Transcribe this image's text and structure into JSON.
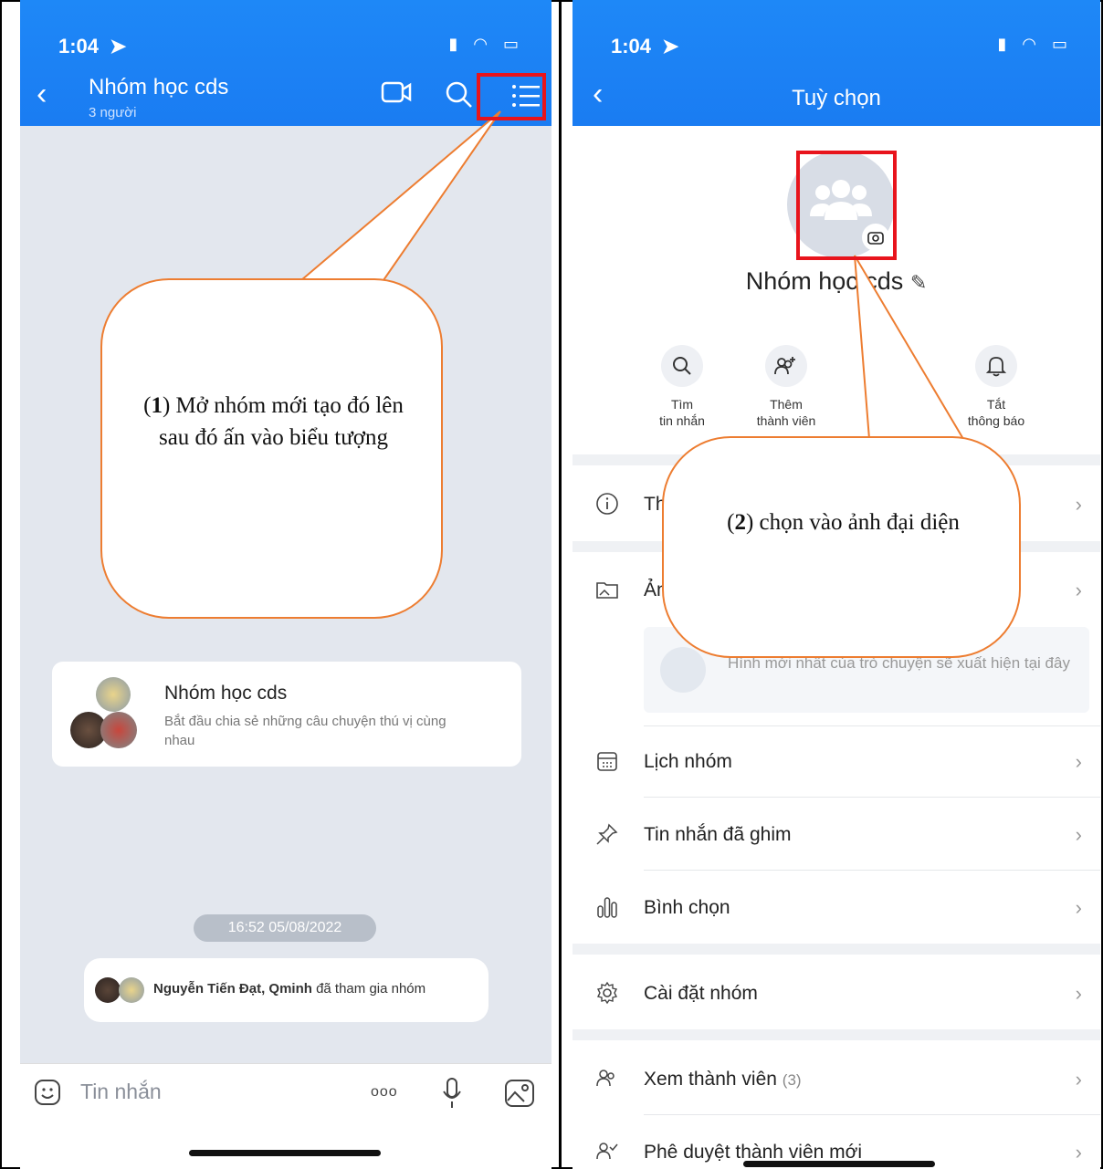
{
  "left": {
    "status_time": "1:04",
    "back_glyph": "‹",
    "title": "Nhóm học cds",
    "subtitle": "3 người",
    "card": {
      "name": "Nhóm học cds",
      "desc": "Bắt đầu chia sẻ những câu chuyện thú vị cùng nhau"
    },
    "date_pill": "16:52 05/08/2022",
    "join": {
      "names": "Nguyễn Tiến Đạt, Qminh",
      "suffix": " đã tham gia nhóm"
    },
    "input_placeholder": "Tin nhắn",
    "more_glyph": "ooo",
    "callout": {
      "num": "1",
      "text": ") Mở nhóm mới tạo đó lên sau đó ấn vào biểu tượng",
      "open": "("
    }
  },
  "right": {
    "status_time": "1:04",
    "back_glyph": "‹",
    "title": "Tuỳ chọn",
    "group_name": "Nhóm học cds",
    "actions": [
      {
        "l1": "Tìm",
        "l2": "tin nhắn"
      },
      {
        "l1": "Thêm",
        "l2": "thành viên"
      },
      {
        "l1": "Tắt",
        "l2": "thông báo"
      }
    ],
    "row_info": "Th",
    "row_photo": "Ản",
    "photo_hint": "Hình mới nhất của trò chuyện sẽ xuất hiện tại đây",
    "rows": [
      {
        "label": "Lịch nhóm"
      },
      {
        "label": "Tin nhắn đã ghim"
      },
      {
        "label": "Bình chọn"
      },
      {
        "label": "Cài đặt nhóm"
      },
      {
        "label": "Xem thành viên",
        "count": "(3)"
      },
      {
        "label": "Phê duyệt thành viên mới"
      }
    ],
    "chevron": "›",
    "callout": {
      "open": "(",
      "num": "2",
      "text": ") chọn vào ảnh đại diện"
    }
  },
  "colors": {
    "header_blue": "#1a7cf2",
    "callout_orange": "#ed7d31",
    "highlight_red": "#e8141c"
  }
}
